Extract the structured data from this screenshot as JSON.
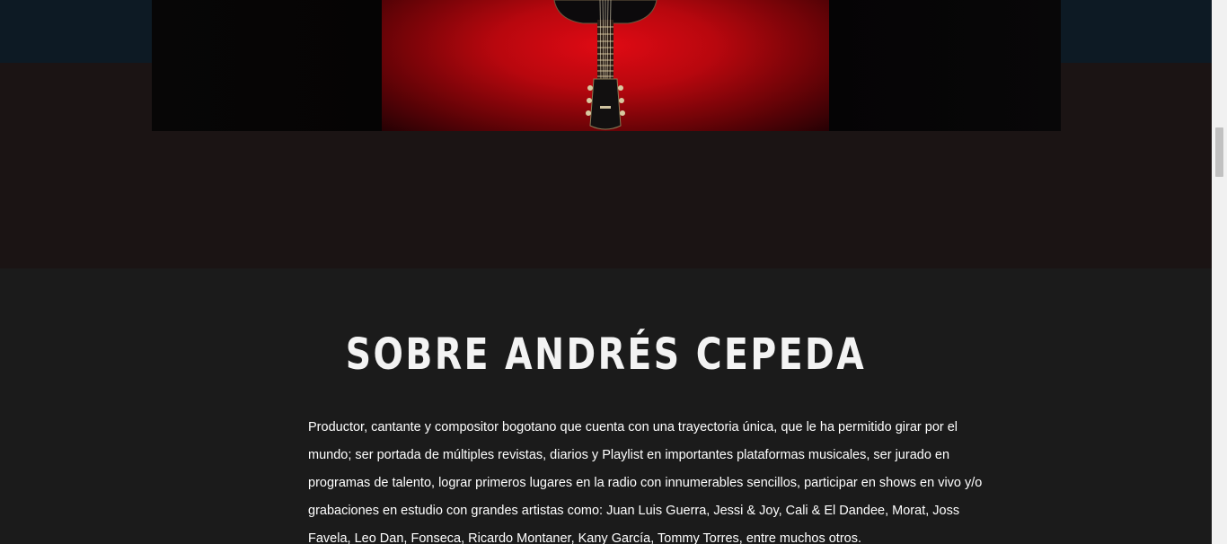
{
  "about": {
    "title": "SOBRE ANDRÉS CEPEDA",
    "paragraph": "Productor, cantante y compositor bogotano que cuenta con una trayectoria única, que le ha permitido girar por el mundo; ser portada de múltiples revistas, diarios y Playlist en importantes plataformas musicales, ser jurado en programas de talento, lograr primeros lugares en la radio con innumerables sencillos, participar en shows en vivo y/o grabaciones en estudio con grandes artistas como: Juan Luis Guerra, Jessi & Joy, Cali & El Dandee, Morat, Joss Favela, Leo Dan, Fonseca, Ricardo Montaner, Kany García, Tommy Torres, entre muchos otros."
  },
  "media": {
    "image_subject": "acoustic guitar on red background"
  },
  "colors": {
    "top_band": "#0d1a24",
    "hero_band": "#1b1414",
    "about_bg": "#1b1b1b",
    "accent_red": "#d10a12",
    "text": "#ffffff"
  }
}
